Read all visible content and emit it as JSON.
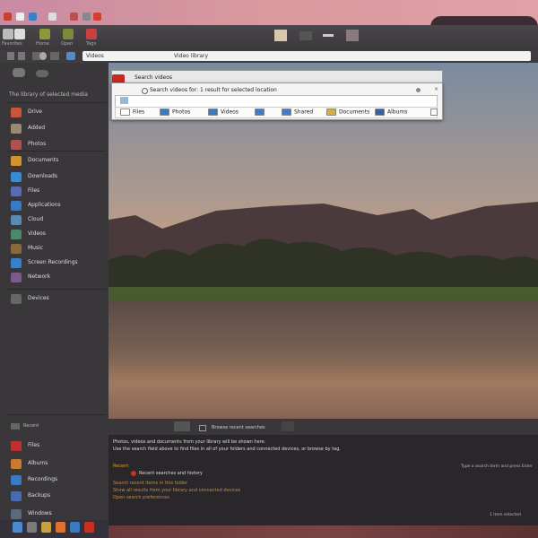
{
  "toolbar": {
    "labels": [
      "Favorites",
      "Home",
      "Open",
      "Tags"
    ]
  },
  "addressbar": {
    "value": "Videos",
    "path_label": "Video library"
  },
  "sidebar": {
    "header": "The library of selected media",
    "items": [
      {
        "label": "Drive",
        "icon": "drive-icon",
        "color": "#c8553a"
      },
      {
        "label": "Added",
        "icon": "folder-icon",
        "color": "#9a8a70"
      },
      {
        "label": "Photos",
        "icon": "photos-icon",
        "color": "#b05050"
      },
      {
        "label": "Documents",
        "icon": "documents-icon",
        "color": "#d4932a"
      },
      {
        "label": "Downloads",
        "icon": "downloads-icon",
        "color": "#3a8ad0"
      },
      {
        "label": "Files",
        "icon": "files-icon",
        "color": "#5a6ab0"
      },
      {
        "label": "Applications",
        "icon": "applications-icon",
        "color": "#3a7ac0"
      },
      {
        "label": "Cloud",
        "icon": "cloud-icon",
        "color": "#5a8ab0"
      },
      {
        "label": "Videos",
        "icon": "videos-icon",
        "color": "#4a8a6a"
      },
      {
        "label": "Music",
        "icon": "music-icon",
        "color": "#8a6a3a"
      },
      {
        "label": "Screen Recordings",
        "icon": "screen-icon",
        "color": "#3a80c8"
      },
      {
        "label": "Network",
        "icon": "network-icon",
        "color": "#7a5a8a"
      },
      {
        "label": "Devices",
        "icon": "devices-icon",
        "color": "#666666"
      }
    ],
    "section_label": "Recent",
    "lower_items": [
      {
        "label": "Files",
        "icon": "files-red-icon",
        "color": "#c03030"
      },
      {
        "label": "Albums",
        "icon": "albums-icon",
        "color": "#c87a30"
      },
      {
        "label": "Recordings",
        "icon": "recordings-icon",
        "color": "#3a7ac0"
      },
      {
        "label": "Backups",
        "icon": "backups-icon",
        "color": "#4a6ab0"
      },
      {
        "label": "Windows",
        "icon": "windows-icon",
        "color": "#5a6a80"
      }
    ]
  },
  "dialog": {
    "title": "Search videos",
    "query": "Search videos for: 1 result for selected location",
    "tabs": [
      {
        "label": "Files",
        "color": "#ffffff"
      },
      {
        "label": "Photos",
        "color": "#3a7ac0"
      },
      {
        "label": "Videos",
        "color": "#3a7ac0"
      },
      {
        "label": "",
        "color": "#3a80c8"
      },
      {
        "label": "Shared",
        "color": "#3a80c8"
      },
      {
        "label": "Documents",
        "color": "#d4b040"
      },
      {
        "label": "Albums",
        "color": "#3a60a0"
      }
    ]
  },
  "lower_panel": {
    "bar_label": "Browse recent searches",
    "line1": "Photos, videos and documents from your library will be shown here.",
    "line2": "Use the search field above to find files in all of your folders and connected devices, or browse by tag.",
    "section": "Recent",
    "item1": "Recent searches and history",
    "orange_lines": [
      "Search recent items in this folder",
      "Show all results from your library and connected devices",
      "Open search preferences"
    ],
    "right_note": "Type a search term and press Enter",
    "right_status": "1 item selected"
  },
  "dock": {
    "icons": [
      {
        "name": "dock-mail-icon",
        "color": "#4a8ad0"
      },
      {
        "name": "dock-files-icon",
        "color": "#7a7a7a"
      },
      {
        "name": "dock-photos-icon",
        "color": "#c8a040"
      },
      {
        "name": "dock-music-icon",
        "color": "#e07030"
      },
      {
        "name": "dock-store-icon",
        "color": "#3a7ac0"
      },
      {
        "name": "dock-power-icon",
        "color": "#c83020"
      }
    ]
  }
}
